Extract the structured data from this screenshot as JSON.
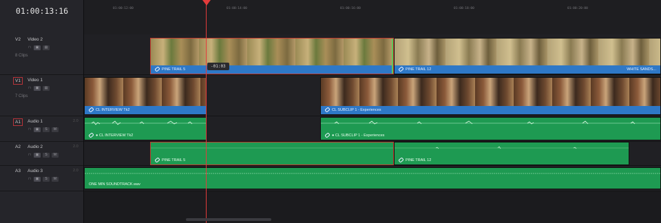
{
  "timecode": "01:00:13:16",
  "ruler": {
    "labels": [
      "01:00:12:00",
      "01:00:14:00",
      "01:00:16:00",
      "01:00:18:00",
      "01:00:20:00"
    ]
  },
  "tracks": [
    {
      "id": "V2",
      "name": "Video 2",
      "clips": "8 Clips",
      "extra": ""
    },
    {
      "id": "V1",
      "name": "Video 1",
      "clips": "7 Clips",
      "extra": ""
    },
    {
      "id": "A1",
      "name": "Audio 1",
      "clips": "",
      "extra": "2.0",
      "solo": "S",
      "mute": "M"
    },
    {
      "id": "A2",
      "name": "Audio 2",
      "clips": "",
      "extra": "2.0",
      "solo": "S",
      "mute": "M"
    },
    {
      "id": "A3",
      "name": "Audio 3",
      "clips": "",
      "extra": "2.0",
      "solo": "S",
      "mute": "M"
    }
  ],
  "clips": {
    "v2_a": "PINE TRAIL 5",
    "v2_b": "PINE TRAIL 12",
    "v2_b_right": "WHITE SANDS...",
    "v1_a": "CL INTERVIEW Tk2",
    "v1_b": "CL SUBCLIP 1 - Experiences",
    "a1_a": "● CL INTERVIEW Tk2",
    "a1_b": "● CL SUBCLIP 1 - Experiences",
    "a2_a": "PINE TRAIL 5",
    "a2_b": "PINE TRAIL 12",
    "a3_a": "ONE MIN SOUNDTRACK.wav"
  },
  "trim_readout": "-01:03",
  "colors": {
    "playhead": "#e43b3b",
    "video_label": "#2e78c7",
    "audio_clip": "#1e9a52",
    "selected_border": "#c23a2e"
  }
}
